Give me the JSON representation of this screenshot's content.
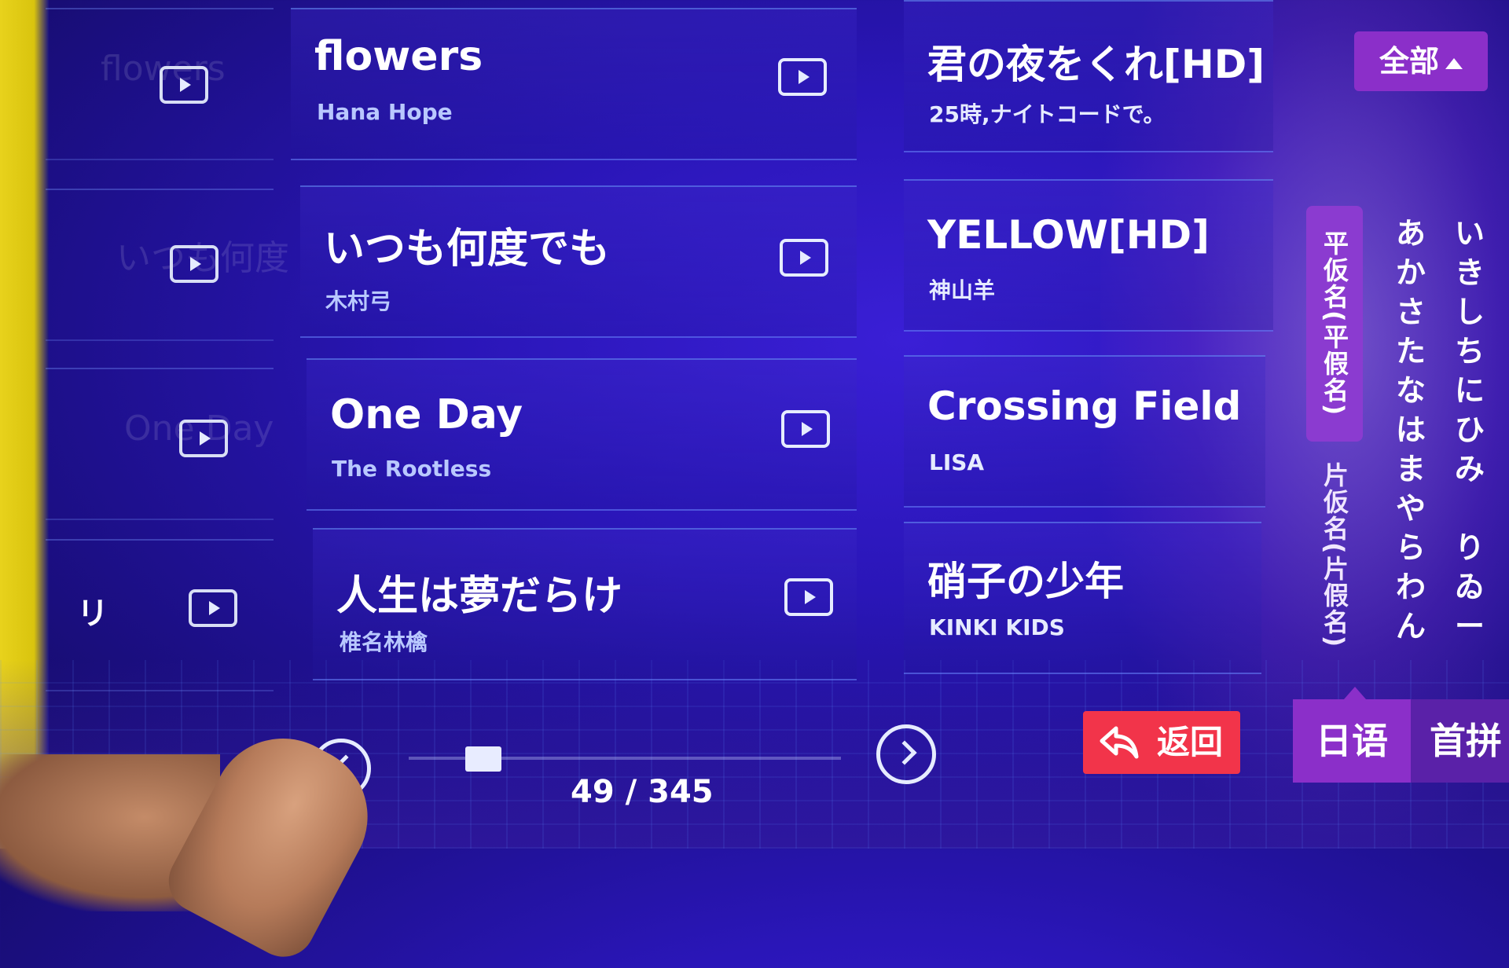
{
  "filter": {
    "label": "全部"
  },
  "ghost_column": {
    "items": [
      "flowers",
      "いつも何度",
      "One Day",
      "リ"
    ],
    "edge_label": "リ"
  },
  "songs_left": [
    {
      "title": "flowers",
      "artist": "Hana Hope"
    },
    {
      "title": "いつも何度でも",
      "artist": "木村弓"
    },
    {
      "title": "One Day",
      "artist": "The Rootless"
    },
    {
      "title": "人生は夢だらけ",
      "artist": "椎名林檎"
    }
  ],
  "songs_right": [
    {
      "title": "君の夜をくれ[HD]",
      "artist": "25時,ナイトコードで。"
    },
    {
      "title": "YELLOW[HD]",
      "artist": "神山羊"
    },
    {
      "title": "Crossing Field",
      "artist": "LISA"
    },
    {
      "title": "硝子の少年",
      "artist": "KINKI KIDS"
    }
  ],
  "side_tabs": {
    "hiragana": "平仮名(平假名)",
    "katakana": "片仮名(片假名)"
  },
  "kana": {
    "col1": "あ\nか\nさ\nた\nな\nは\nま\nや\nら\nわ\nん",
    "col2": "い\nき\nし\nち\nに\nひ\nみ\n\nり\nゐ\nー"
  },
  "lang_tabs": {
    "japanese": "日语",
    "pinyin": "首拼"
  },
  "back_button": {
    "label": "返回"
  },
  "pagination": {
    "current": 49,
    "total": 345,
    "text": "49 / 345",
    "progress_fraction": 0.142
  },
  "colors": {
    "accent_purple": "#8b2fc9",
    "back_red": "#f2344a",
    "background_blue": "#2a16b8"
  },
  "icons": {
    "play": "play-icon",
    "prev": "chevron-left-icon",
    "next": "chevron-right-icon",
    "back": "undo-arrow-icon"
  }
}
